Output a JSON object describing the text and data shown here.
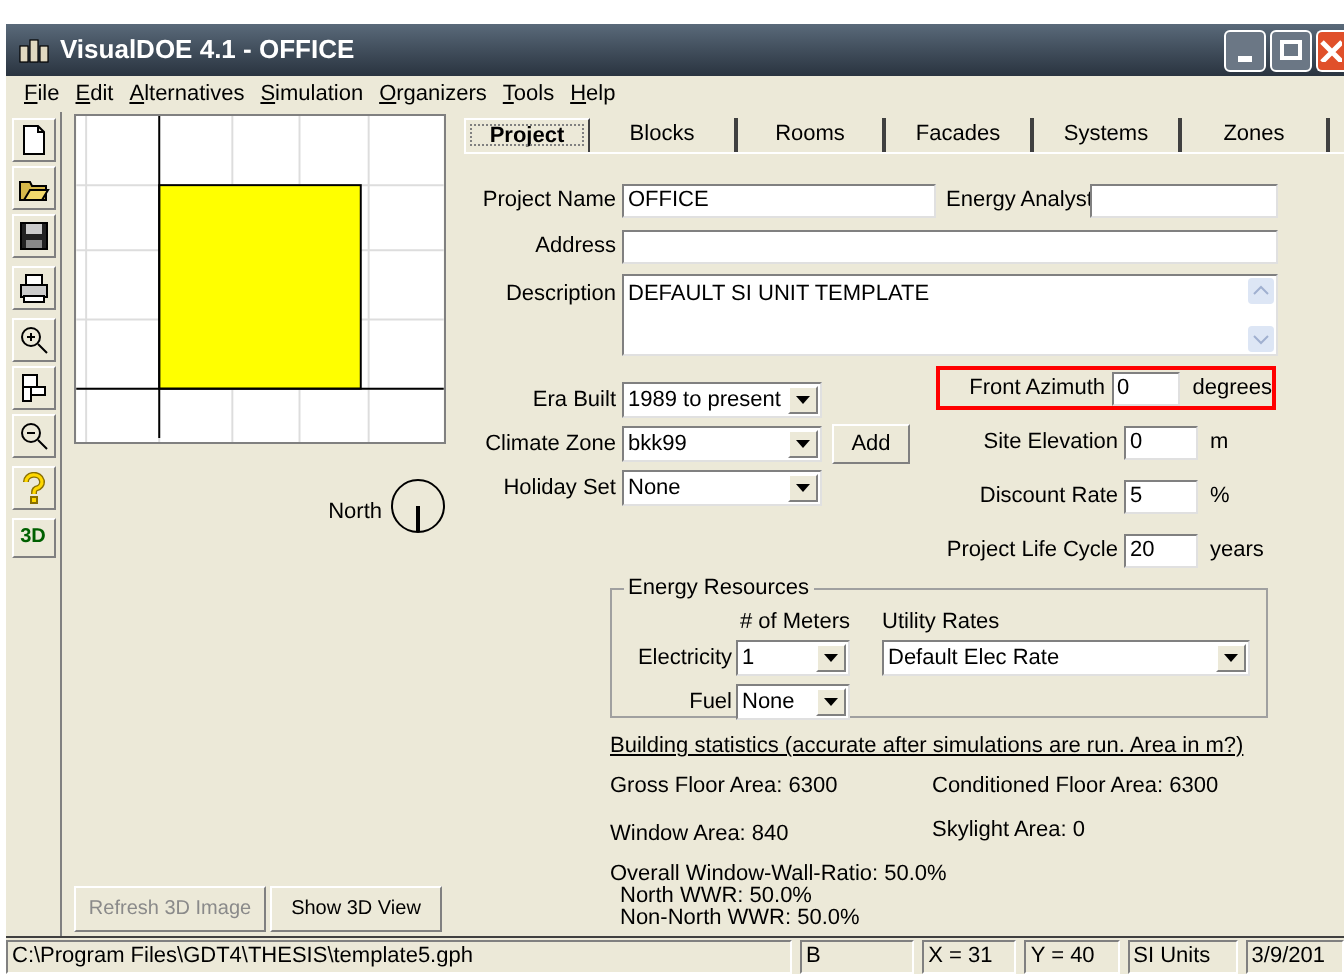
{
  "window": {
    "title": "VisualDOE 4.1 - OFFICE"
  },
  "menu": [
    "File",
    "Edit",
    "Alternatives",
    "Simulation",
    "Organizers",
    "Tools",
    "Help"
  ],
  "toolbar": [
    {
      "kind": "new"
    },
    {
      "kind": "open"
    },
    {
      "kind": "save"
    },
    {
      "kind": "print"
    },
    {
      "kind": "zoom-in"
    },
    {
      "kind": "layout"
    },
    {
      "kind": "zoom-out"
    },
    {
      "kind": "help"
    },
    {
      "kind": "text",
      "label": "3D"
    }
  ],
  "plan": {
    "north_label": "North"
  },
  "view_buttons": [
    {
      "label": "Refresh 3D Image",
      "disabled": true
    },
    {
      "label": "Show 3D View",
      "disabled": false
    }
  ],
  "tabs": [
    {
      "label": "Project",
      "selected": true
    },
    {
      "label": "Blocks",
      "selected": false
    },
    {
      "label": "Rooms",
      "selected": false
    },
    {
      "label": "Facades",
      "selected": false
    },
    {
      "label": "Systems",
      "selected": false
    },
    {
      "label": "Zones",
      "selected": false
    }
  ],
  "project": {
    "name": {
      "label": "Project Name",
      "value": "OFFICE"
    },
    "analyst": {
      "label": "Energy Analyst"
    },
    "address": {
      "label": "Address"
    },
    "description": {
      "label": "Description",
      "value": "DEFAULT SI UNIT TEMPLATE"
    }
  },
  "selects": [
    {
      "label": "Era Built",
      "value": "1989 to present"
    },
    {
      "label": "Climate Zone",
      "value": "bkk99",
      "button": "Add"
    },
    {
      "label": "Holiday Set",
      "value": "None"
    }
  ],
  "numbers": [
    {
      "label": "Front Azimuth",
      "value": "0",
      "unit": "degrees",
      "highlighted": true
    },
    {
      "label": "Site Elevation",
      "value": "0",
      "unit": "m",
      "highlighted": false
    },
    {
      "label": "Discount Rate",
      "value": "5",
      "unit": "%",
      "highlighted": false
    },
    {
      "label": "Project Life Cycle",
      "value": "20",
      "unit": "years",
      "highlighted": false
    }
  ],
  "energy": {
    "title": "Energy Resources",
    "meters_heading": "# of Meters",
    "rates_heading": "Utility Rates",
    "electricity": {
      "label": "Electricity",
      "meters": "1",
      "rate": "Default Elec Rate"
    },
    "fuel": {
      "label": "Fuel",
      "meters": "None"
    }
  },
  "stats": {
    "heading": "Building statistics (accurate after simulations are run. Area in m?)",
    "gross": "Gross Floor Area: 6300",
    "conditioned": "Conditioned Floor Area: 6300",
    "window": "Window Area: 840",
    "skylight": "Skylight Area: 0",
    "wwr": [
      "Overall Window-Wall-Ratio: 50.0%",
      "North WWR: 50.0%",
      "Non-North WWR: 50.0%"
    ]
  },
  "status_bar": [
    "C:\\Program Files\\GDT4\\THESIS\\template5.gph",
    "B",
    "X = 31",
    "Y = 40",
    "SI Units",
    "3/9/201"
  ]
}
